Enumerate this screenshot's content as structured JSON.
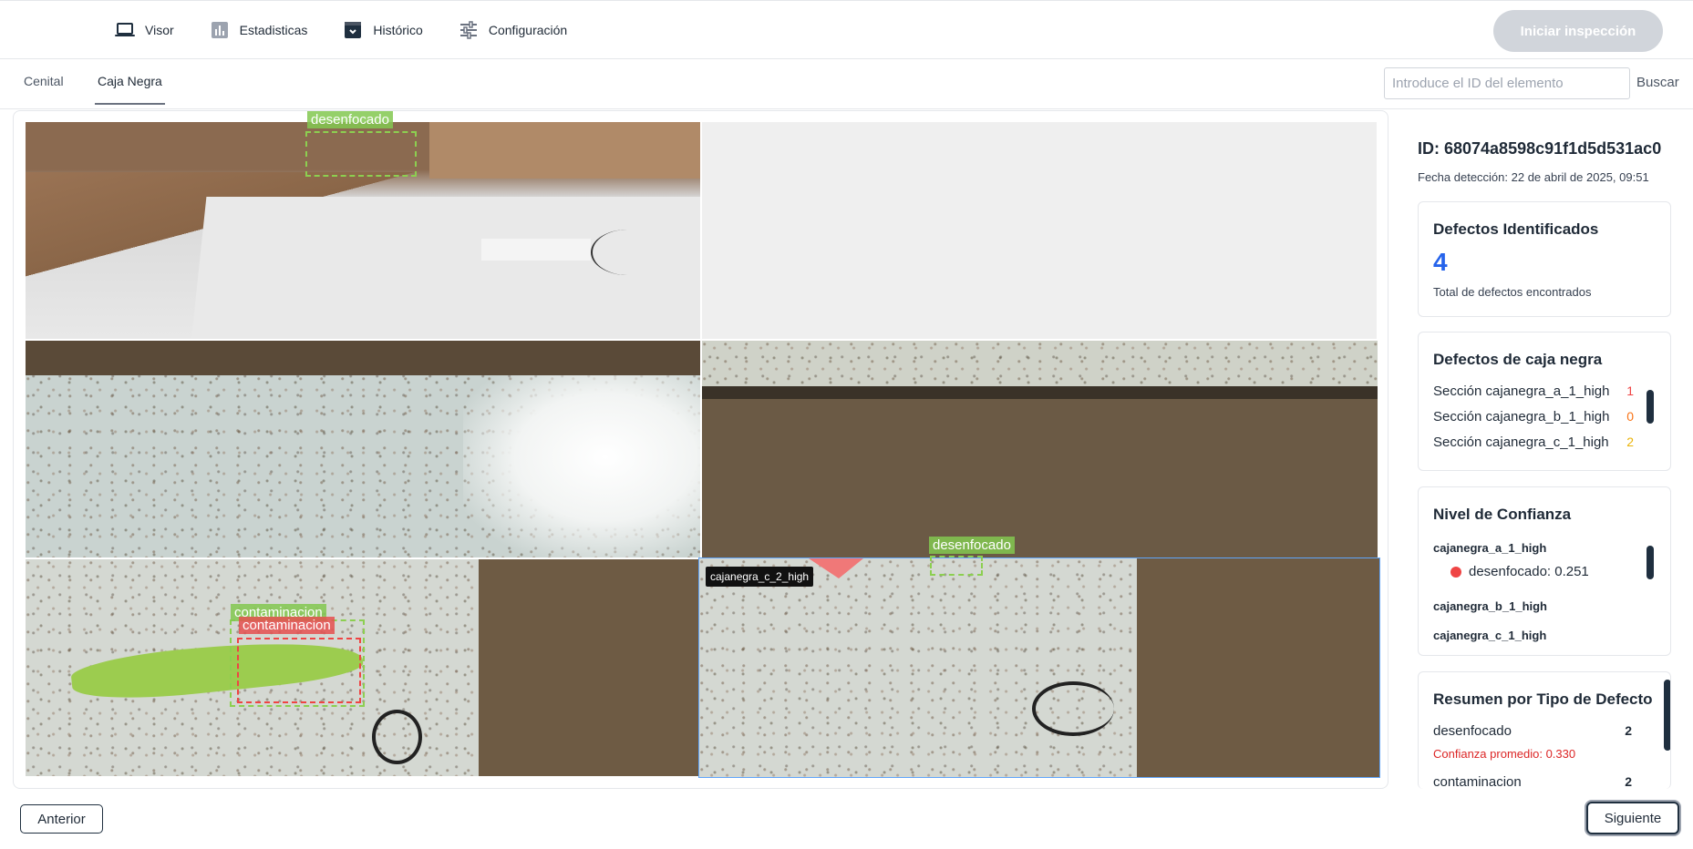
{
  "nav": {
    "items": [
      {
        "label": "Visor",
        "icon": "laptop-icon"
      },
      {
        "label": "Estadisticas",
        "icon": "bar-chart-icon"
      },
      {
        "label": "Histórico",
        "icon": "archive-icon"
      },
      {
        "label": "Configuración",
        "icon": "sliders-icon"
      }
    ],
    "start_label": "Iniciar inspección"
  },
  "tabs": {
    "items": [
      "Cenital",
      "Caja Negra"
    ],
    "active": "Caja Negra"
  },
  "search": {
    "placeholder": "Introduce el ID del elemento",
    "value": "",
    "button_label": "Buscar"
  },
  "viewer": {
    "labels": {
      "desenfocado_top": "desenfocado",
      "desenfocado_bottom": "desenfocado",
      "contaminacion_green": "contaminacion",
      "contaminacion_red": "contaminacion",
      "selected_tag": "cajanegra_c_2_high"
    }
  },
  "detail": {
    "id_text": "ID: 68074a8598c91f1d5d531ac0",
    "date_text": "Fecha detección: 22 de abril de 2025, 09:51"
  },
  "defects_identified": {
    "title": "Defectos Identificados",
    "count": "4",
    "caption": "Total de defectos encontrados"
  },
  "black_box": {
    "title": "Defectos de caja negra",
    "rows": [
      {
        "label": "Sección cajanegra_a_1_high",
        "value": "1",
        "color": "#ef4444"
      },
      {
        "label": "Sección cajanegra_b_1_high",
        "value": "0",
        "color": "#f97316"
      },
      {
        "label": "Sección cajanegra_c_1_high",
        "value": "2",
        "color": "#eab308"
      }
    ]
  },
  "confidence": {
    "title": "Nivel de Confianza",
    "groups": [
      {
        "name": "cajanegra_a_1_high",
        "item": "desenfocado: 0.251"
      },
      {
        "name": "cajanegra_b_1_high"
      },
      {
        "name": "cajanegra_c_1_high"
      }
    ]
  },
  "summary": {
    "title": "Resumen por Tipo de Defecto",
    "rows": [
      {
        "type": "desenfocado",
        "count": "2",
        "avg": "Confianza promedio: 0.330"
      },
      {
        "type": "contaminacion",
        "count": "2"
      }
    ]
  },
  "footer": {
    "prev_label": "Anterior",
    "next_label": "Siguiente"
  },
  "colors": {
    "accent_blue": "#2563eb",
    "red": "#ef4444",
    "orange": "#f97316",
    "yellow": "#eab308",
    "dark": "#1f2f3f"
  }
}
